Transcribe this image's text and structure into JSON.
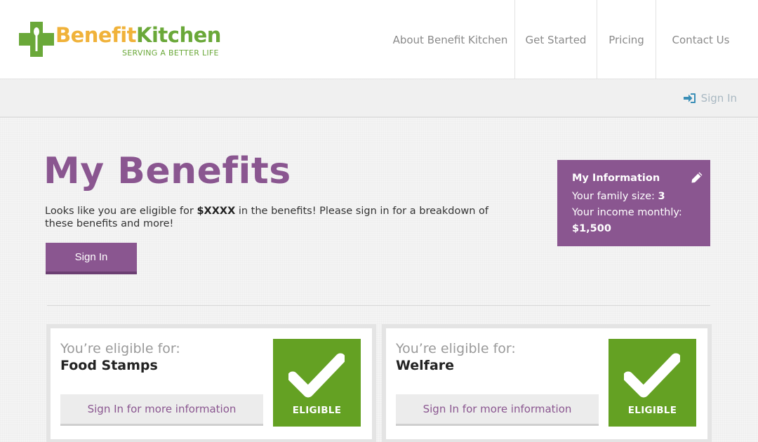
{
  "header": {
    "logo": {
      "word1": "Benefit",
      "word2": "Kitchen",
      "tagline": "SERVING A BETTER LIFE"
    },
    "nav": [
      {
        "label": "About Benefit Kitchen"
      },
      {
        "label": "Get Started"
      },
      {
        "label": "Pricing"
      },
      {
        "label": "Contact Us"
      }
    ]
  },
  "subbar": {
    "signin_label": "Sign In"
  },
  "main": {
    "title": "My Benefits",
    "intro_before": "Looks like you are eligible for ",
    "intro_amount": "$XXXX",
    "intro_after": " in the benefits! Please sign in for a breakdown of these benefits and more!",
    "signin_button": "Sign In"
  },
  "info": {
    "title": "My Information",
    "family_label": "Your family size: ",
    "family_value": "3",
    "income_label": "Your income monthly:",
    "income_value": "$1,500"
  },
  "cards": [
    {
      "pre": "You’re eligible for:",
      "name": "Food Stamps",
      "link": "Sign In for more information",
      "badge": "ELIGIBLE"
    },
    {
      "pre": "You’re eligible for:",
      "name": "Welfare",
      "link": "Sign In for more information",
      "badge": "ELIGIBLE"
    }
  ],
  "colors": {
    "brand_purple": "#8a5690",
    "brand_green": "#6aa839",
    "brand_orange": "#f0b23a",
    "eligible_green": "#64a123"
  },
  "icons": {
    "signin": "sign-in-icon",
    "edit": "pencil-icon",
    "eligible": "checkmark-icon"
  }
}
